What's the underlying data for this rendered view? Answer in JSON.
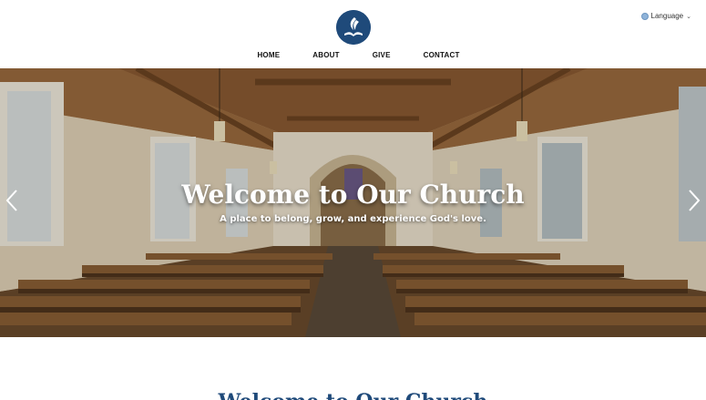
{
  "header": {
    "language_label": "Language",
    "nav": [
      {
        "label": "HOME"
      },
      {
        "label": "ABOUT"
      },
      {
        "label": "GIVE"
      },
      {
        "label": "CONTACT"
      }
    ]
  },
  "hero": {
    "title": "Welcome to Our Church",
    "subtitle": "A place to belong, grow, and experience God's love."
  },
  "section": {
    "title": "Welcome to Our Church"
  },
  "colors": {
    "brand": "#1f4a7a",
    "nav_text": "#111111",
    "hero_text": "#ffffff"
  },
  "icons": {
    "logo": "church-logo-icon",
    "language": "globe-icon",
    "prev": "chevron-left-icon",
    "next": "chevron-right-icon"
  }
}
